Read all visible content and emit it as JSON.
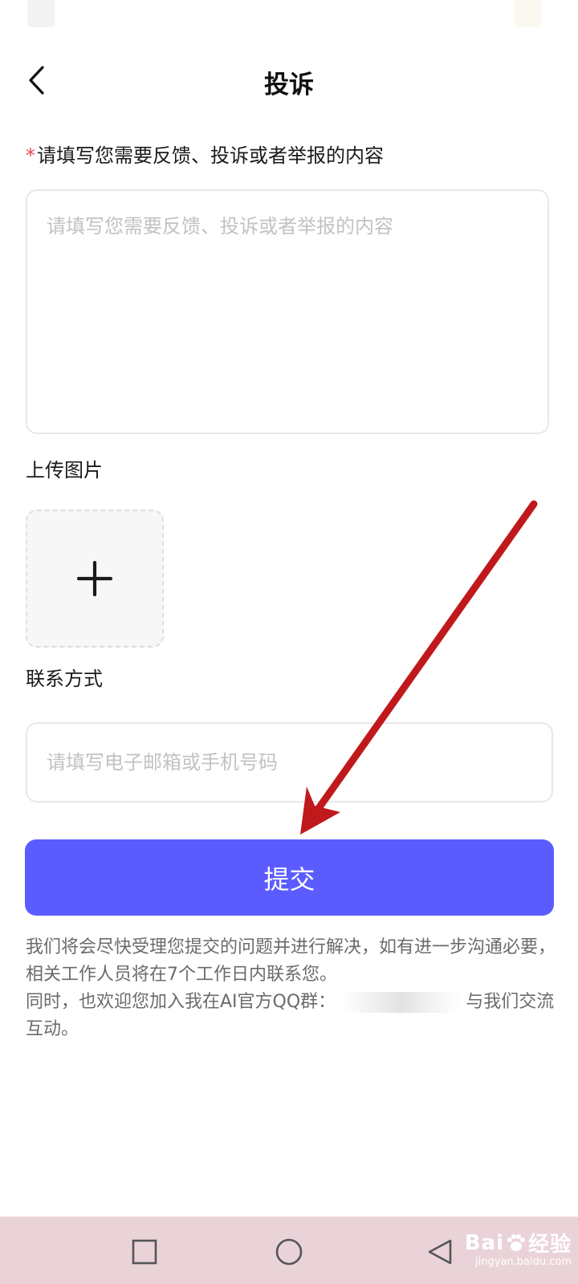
{
  "header": {
    "title": "投诉"
  },
  "feedback": {
    "required_mark": "*",
    "label": "请填写您需要反馈、投诉或者举报的内容",
    "placeholder": "请填写您需要反馈、投诉或者举报的内容"
  },
  "upload": {
    "label": "上传图片"
  },
  "contact": {
    "label": "联系方式",
    "placeholder": "请填写电子邮箱或手机号码"
  },
  "submit": {
    "label": "提交",
    "color": "#5b5cff"
  },
  "notice": {
    "line1": "我们将会尽快受理您提交的问题并进行解决，如有进一步沟通必要，相关工作人员将在7个工作日内联系您。",
    "line2_prefix": "同时，也欢迎您加入我在AI官方QQ群：",
    "line2_suffix": "与我们交流互动。"
  },
  "annotation": {
    "color": "#c0191b"
  },
  "nav_bar": {
    "buttons": [
      "recent-apps-icon",
      "home-icon",
      "back-icon"
    ],
    "color": "#ead3d8"
  },
  "watermark": {
    "main": "Bai",
    "main_suffix": "经验",
    "sub": "jingyan.baidu.com"
  }
}
